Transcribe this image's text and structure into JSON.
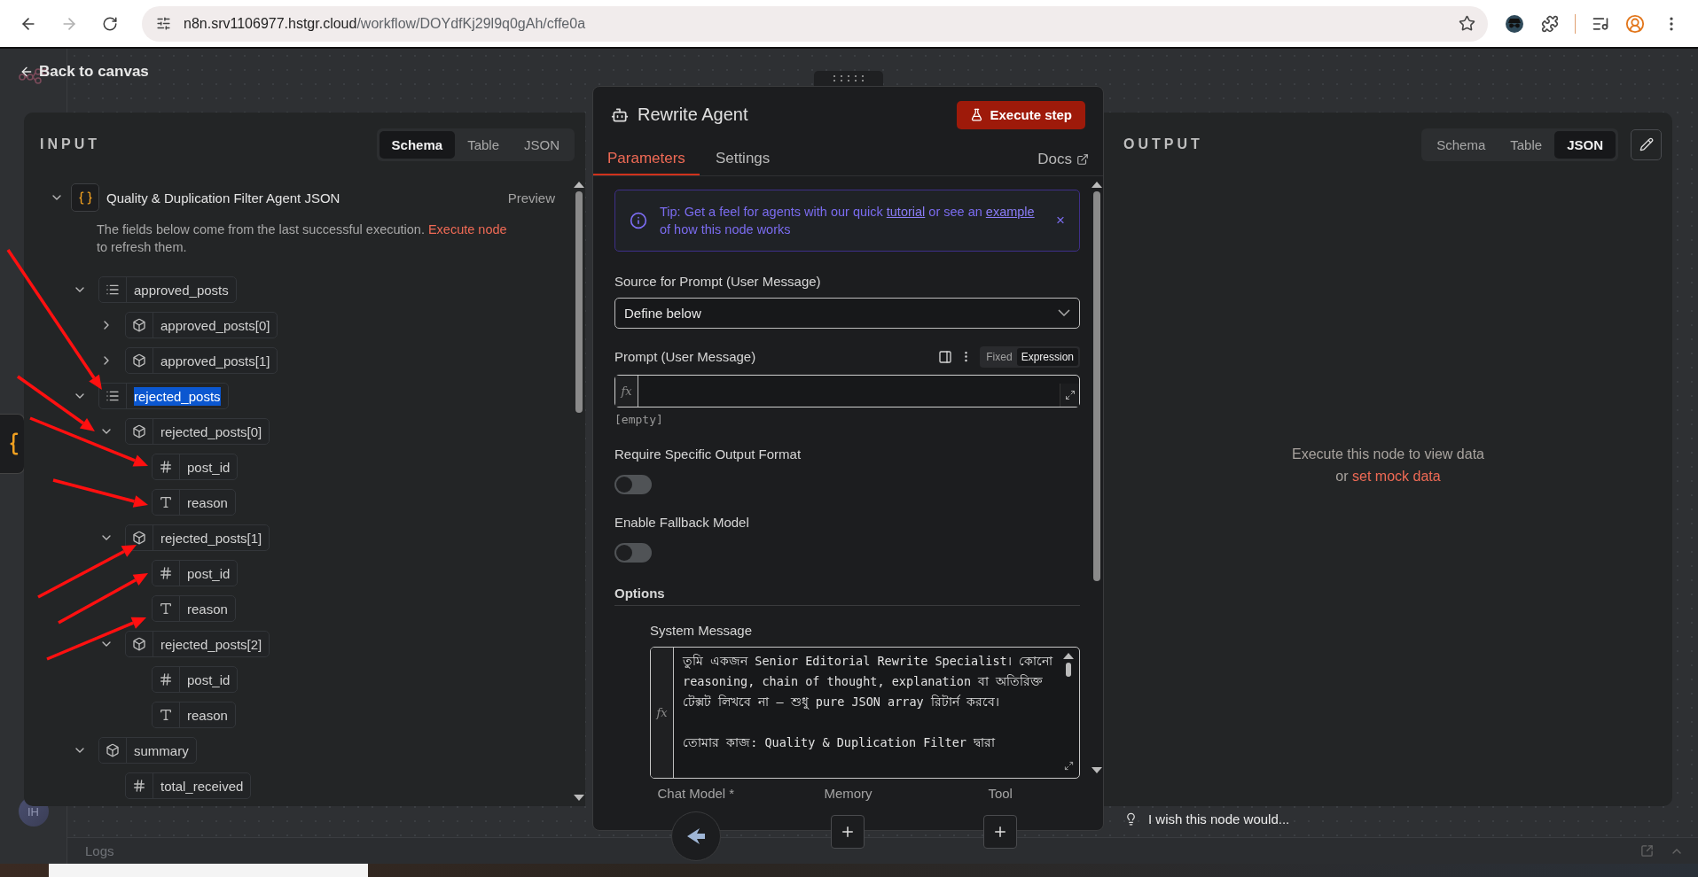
{
  "browser": {
    "url_host": "n8n.srv1106977.hstgr.cloud",
    "url_path": "/workflow/DOYdfKj29l9q0gAh/cffe0a",
    "forward_disabled": true
  },
  "back_link": "Back to canvas",
  "input_panel": {
    "title": "INPUT",
    "tabs": [
      {
        "label": "Schema",
        "selected": true
      },
      {
        "label": "Table",
        "selected": false
      },
      {
        "label": "JSON",
        "selected": false
      }
    ],
    "source": {
      "title": "Quality & Duplication Filter Agent JSON",
      "expanded": true,
      "preview": "Preview",
      "notice": "The fields below come from the last successful execution.",
      "notice_link": "Execute node",
      "notice_end": "to refresh them."
    },
    "tree": [
      {
        "label": "approved_posts",
        "kind": "array",
        "expanded": true,
        "highlighted": false,
        "children": [
          {
            "label": "approved_posts[0]",
            "kind": "object",
            "expanded": false,
            "highlighted": false
          },
          {
            "label": "approved_posts[1]",
            "kind": "object",
            "expanded": false,
            "highlighted": false
          }
        ]
      },
      {
        "label": "rejected_posts",
        "kind": "array",
        "expanded": true,
        "highlighted": true,
        "children": [
          {
            "label": "rejected_posts[0]",
            "kind": "object",
            "expanded": true,
            "highlighted": false,
            "children": [
              {
                "label": "post_id",
                "kind": "number",
                "highlighted": false
              },
              {
                "label": "reason",
                "kind": "string",
                "highlighted": false
              }
            ]
          },
          {
            "label": "rejected_posts[1]",
            "kind": "object",
            "expanded": true,
            "highlighted": false,
            "children": [
              {
                "label": "post_id",
                "kind": "number",
                "highlighted": false
              },
              {
                "label": "reason",
                "kind": "string",
                "highlighted": false
              }
            ]
          },
          {
            "label": "rejected_posts[2]",
            "kind": "object",
            "expanded": true,
            "highlighted": false,
            "children": [
              {
                "label": "post_id",
                "kind": "number",
                "highlighted": false
              },
              {
                "label": "reason",
                "kind": "string",
                "highlighted": false
              }
            ]
          }
        ]
      },
      {
        "label": "summary",
        "kind": "object",
        "expanded": true,
        "highlighted": false,
        "children": [
          {
            "label": "total_received",
            "kind": "number",
            "highlighted": false
          }
        ]
      }
    ]
  },
  "node_panel": {
    "title": "Rewrite Agent",
    "execute_button": "Execute step",
    "tabs": [
      {
        "label": "Parameters",
        "selected": true
      },
      {
        "label": "Settings",
        "selected": false
      }
    ],
    "docs_link": "Docs",
    "tip": {
      "before": "Tip: Get a feel for agents with our quick",
      "link1": "tutorial",
      "middle": "or see an",
      "link2": "example",
      "after": "of how this node works",
      "close": "×"
    },
    "fields": [
      {
        "kind": "select",
        "label": "Source for Prompt (User Message)",
        "value": "Define below"
      },
      {
        "kind": "expression",
        "label": "Prompt (User Message)",
        "modes": [
          {
            "label": "Fixed",
            "selected": false
          },
          {
            "label": "Expression",
            "selected": true
          }
        ],
        "prefix": "fx",
        "result": "[empty]"
      },
      {
        "kind": "toggle",
        "label": "Require Specific Output Format",
        "on": false
      },
      {
        "kind": "toggle",
        "label": "Enable Fallback Model",
        "on": false
      }
    ],
    "options": {
      "title": "Options",
      "system_message": {
        "label": "System Message",
        "prefix": "fx",
        "value": "তুমি একজন Senior Editorial Rewrite Specialist। কোনো reasoning, chain of thought, explanation বা অতিরিক্ত টেক্সট লিখবে না — শুধু pure JSON array রিটার্ন করবে।\n\nতোমার কাজ: Quality & Duplication Filter দ্বারা"
      }
    },
    "connections": [
      {
        "label": "Chat Model *",
        "kind": "model"
      },
      {
        "label": "Memory",
        "kind": "add"
      },
      {
        "label": "Tool",
        "kind": "add"
      }
    ]
  },
  "output_panel": {
    "title": "OUTPUT",
    "tabs": [
      {
        "label": "Schema",
        "selected": false
      },
      {
        "label": "Table",
        "selected": false
      },
      {
        "label": "JSON",
        "selected": true
      }
    ],
    "empty_message": "Execute this node to view data",
    "empty_or": "or",
    "empty_link": "set mock data"
  },
  "feedback_prompt": "I wish this node would...",
  "logs": {
    "title": "Logs"
  },
  "user": {
    "initials": "IH"
  }
}
